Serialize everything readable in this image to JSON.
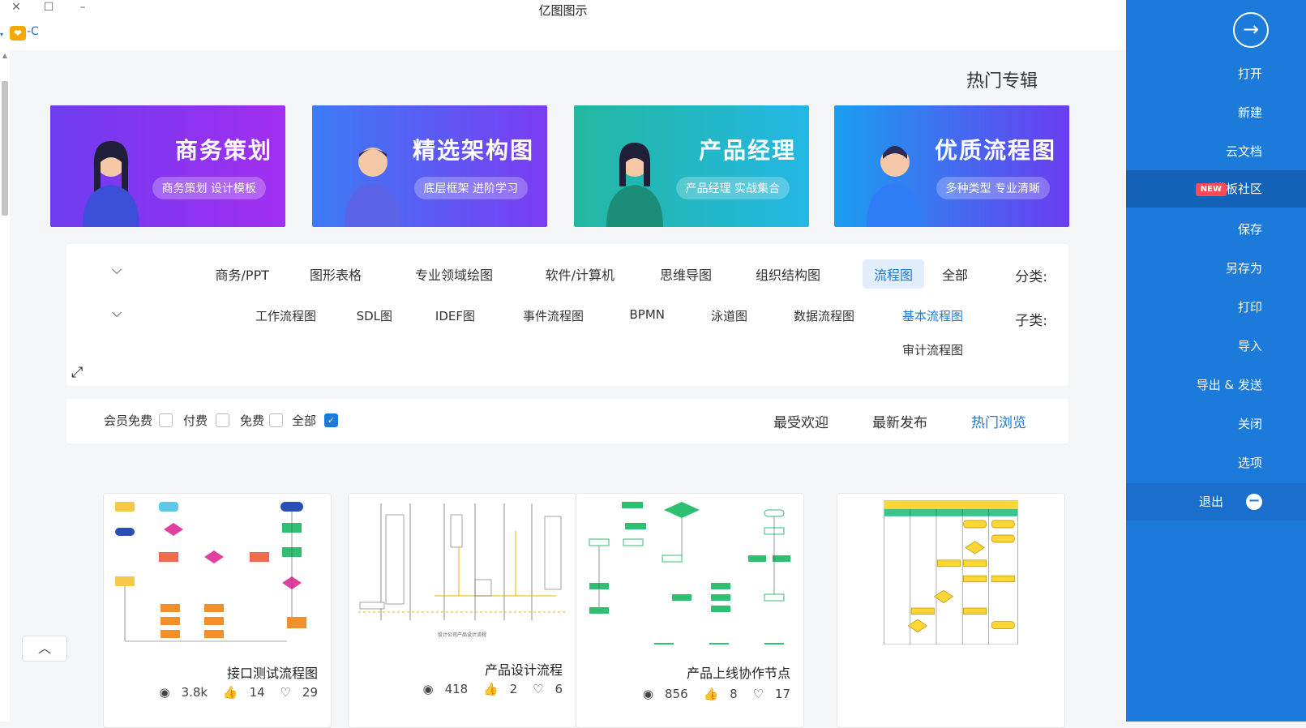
{
  "window": {
    "title": "亿图图示",
    "close": "✕",
    "maximize": "☐",
    "minimize": "–"
  },
  "logo": {
    "badge": "❤",
    "text": "-C"
  },
  "sidebar": {
    "back_icon": "→",
    "items": [
      {
        "label": "打开"
      },
      {
        "label": "新建"
      },
      {
        "label": "云文档"
      },
      {
        "label": "模板社区",
        "badge": "NEW"
      },
      {
        "label": "保存"
      },
      {
        "label": "另存为"
      },
      {
        "label": "打印"
      },
      {
        "label": "导入"
      },
      {
        "label": "导出 & 发送"
      },
      {
        "label": "关闭"
      },
      {
        "label": "选项"
      },
      {
        "label": "退出",
        "icon": "−"
      }
    ]
  },
  "section_title": "热门专辑",
  "banners": [
    {
      "title": "优质流程图",
      "subtitle": "多种类型 专业清晰",
      "color_from": "#1a9ef0",
      "color_to": "#6a3cf0"
    },
    {
      "title": "产品经理",
      "subtitle": "产品经理 实战集合",
      "color_from": "#27c6a8",
      "color_to": "#23b7e5"
    },
    {
      "title": "精选架构图",
      "subtitle": "底层框架 进阶学习",
      "color_from": "#3b7cf5",
      "color_to": "#7b3cf2"
    },
    {
      "title": "商务策划",
      "subtitle": "商务策划 设计模板",
      "color_from": "#6e3cf0",
      "color_to": "#a22ef0"
    }
  ],
  "filters": {
    "category_label": "分类:",
    "categories": [
      "全部",
      "流程图",
      "组织结构图",
      "思维导图",
      "软件/计算机",
      "专业领域绘图",
      "图形表格",
      "商务/PPT"
    ],
    "active_category": "流程图",
    "subcategory_label": "子类:",
    "subcategories": [
      "基本流程图",
      "数据流程图",
      "泳道图",
      "BPMN",
      "事件流程图",
      "IDEF图",
      "SDL图",
      "工作流程图",
      "审计流程图"
    ],
    "active_subcategory": "基本流程图",
    "chevron": "⌵",
    "expand_icon": "⤢"
  },
  "sortbar": {
    "sorts": [
      "热门浏览",
      "最新发布",
      "最受欢迎"
    ],
    "active_sort": "热门浏览",
    "checkboxes": [
      {
        "label": "全部",
        "checked": true
      },
      {
        "label": "免费",
        "checked": false
      },
      {
        "label": "付费",
        "checked": false
      },
      {
        "label": "会员免费",
        "checked": false
      }
    ]
  },
  "cards": [
    {
      "title": "",
      "views": "",
      "likes": "",
      "favs": "",
      "type": "swimlane-yellow"
    },
    {
      "title": "产品上线协作节点",
      "views": "856",
      "likes": "8",
      "favs": "17",
      "type": "flow-green"
    },
    {
      "title": "产品设计流程",
      "views": "418",
      "likes": "2",
      "favs": "6",
      "type": "lanes-gray"
    },
    {
      "title": "接口测试流程图",
      "views": "3.8k",
      "likes": "14",
      "favs": "29",
      "type": "flow-color"
    }
  ],
  "icons": {
    "eye": "👁",
    "like": "👍",
    "heart": "♡"
  },
  "to_top": "︿"
}
